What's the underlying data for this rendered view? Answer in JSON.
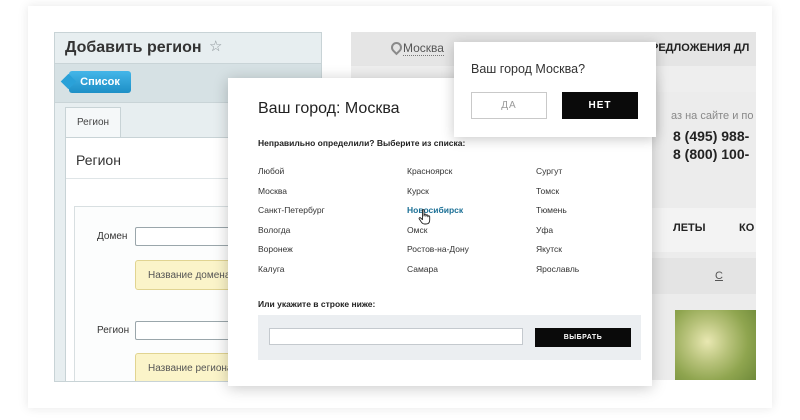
{
  "admin": {
    "title": "Добавить регион",
    "list_button": "Список",
    "tab": "Регион",
    "section_title": "Регион",
    "domain_label": "Домен",
    "domain_hint": "Название домена",
    "region_label": "Регион",
    "region_hint": "Название региона"
  },
  "site": {
    "city": "Москва",
    "promo": "РЕДЛОЖЕНИЯ ДЛ",
    "note": "аз на сайте и по",
    "phones": [
      "8 (495) 988-",
      "8 (800) 100-"
    ],
    "nav": [
      "ЛЕТЫ",
      "КО"
    ],
    "sub_link": "С"
  },
  "modal": {
    "title": "Ваш город: Москва",
    "subtitle": "Неправильно определили? Выберите из списка:",
    "cities": [
      [
        "Любой",
        "Москва",
        "Санкт-Петербург",
        "Вологда",
        "Воронеж",
        "Калуга"
      ],
      [
        "Красноярск",
        "Курск",
        "Новосибирск",
        "Омск",
        "Ростов-на-Дону",
        "Самара"
      ],
      [
        "Сургут",
        "Томск",
        "Тюмень",
        "Уфа",
        "Якутск",
        "Ярославль"
      ]
    ],
    "active_city": "Новосибирск",
    "manual_label": "Или укажите в строке ниже:",
    "input_value": "",
    "choose_button": "ВЫБРАТЬ"
  },
  "popup": {
    "title": "Ваш город Москва?",
    "yes": "ДА",
    "no": "НЕТ"
  },
  "colors": {
    "accent_blue": "#1d8fc6",
    "active_link": "#1a6f95",
    "button_dark": "#0a0a0a",
    "hint_yellow": "#fbf4c9"
  }
}
